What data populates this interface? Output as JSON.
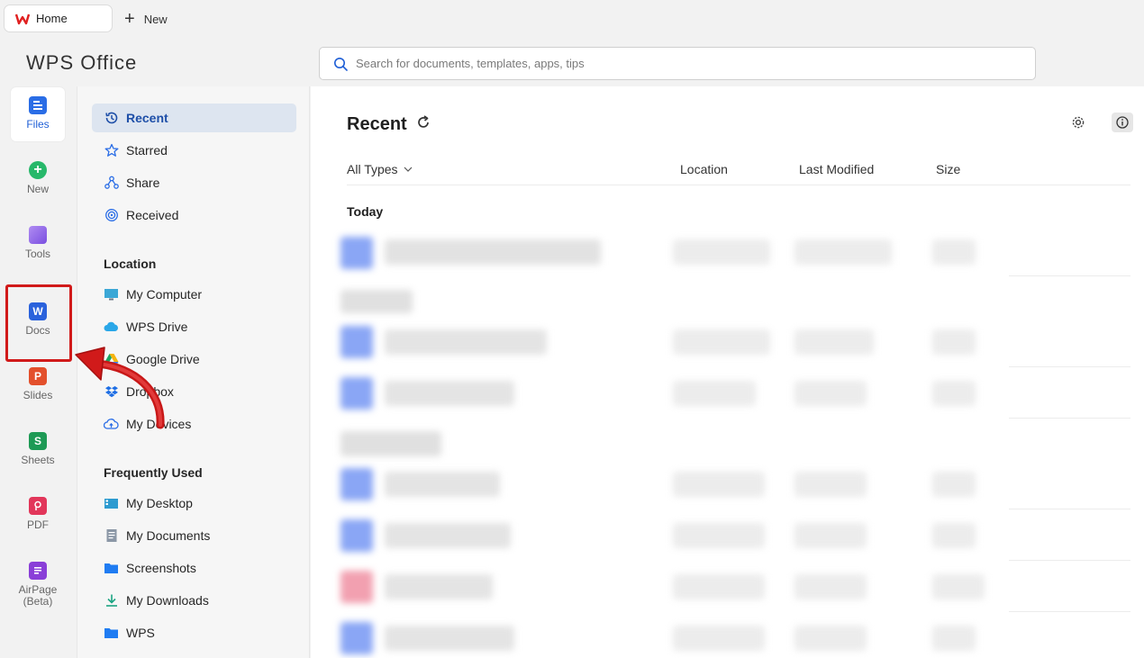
{
  "tabs": {
    "home_label": "Home",
    "new_label": "New"
  },
  "brand": "WPS Office",
  "search": {
    "placeholder": "Search for documents, templates, apps, tips"
  },
  "rail": [
    {
      "label": "Files",
      "icon": "files-icon",
      "active": true
    },
    {
      "label": "New",
      "icon": "new-plus-icon"
    },
    {
      "label": "Tools",
      "icon": "tools-icon"
    },
    {
      "label": "Docs",
      "icon": "docs-w-icon"
    },
    {
      "label": "Slides",
      "icon": "slides-p-icon"
    },
    {
      "label": "Sheets",
      "icon": "sheets-s-icon"
    },
    {
      "label": "PDF",
      "icon": "pdf-icon"
    },
    {
      "label": "AirPage\n(Beta)",
      "icon": "airpage-icon"
    }
  ],
  "sidebar": {
    "main_items": [
      {
        "label": "Recent",
        "icon": "recent-clock-icon",
        "active": true
      },
      {
        "label": "Starred",
        "icon": "star-icon"
      },
      {
        "label": "Share",
        "icon": "share-icon"
      },
      {
        "label": "Received",
        "icon": "received-icon"
      }
    ],
    "location_title": "Location",
    "location_items": [
      {
        "label": "My Computer",
        "icon": "computer-icon"
      },
      {
        "label": "WPS Drive",
        "icon": "cloud-icon"
      },
      {
        "label": "Google Drive",
        "icon": "google-drive-icon"
      },
      {
        "label": "Dropbox",
        "icon": "dropbox-icon"
      },
      {
        "label": "My Devices",
        "icon": "devices-icon"
      }
    ],
    "frequent_title": "Frequently Used",
    "frequent_items": [
      {
        "label": "My Desktop",
        "icon": "desktop-icon"
      },
      {
        "label": "My Documents",
        "icon": "documents-icon"
      },
      {
        "label": "Screenshots",
        "icon": "folder-icon"
      },
      {
        "label": "My Downloads",
        "icon": "download-icon"
      },
      {
        "label": "WPS",
        "icon": "folder-icon"
      }
    ]
  },
  "main": {
    "title": "Recent",
    "filter_label": "All Types",
    "columns": {
      "location": "Location",
      "modified": "Last Modified",
      "size": "Size"
    },
    "group_today": "Today"
  },
  "colors": {
    "accent": "#1f5fd6",
    "annotation": "#d11a1a",
    "active_nav_bg": "#dde5f0"
  }
}
